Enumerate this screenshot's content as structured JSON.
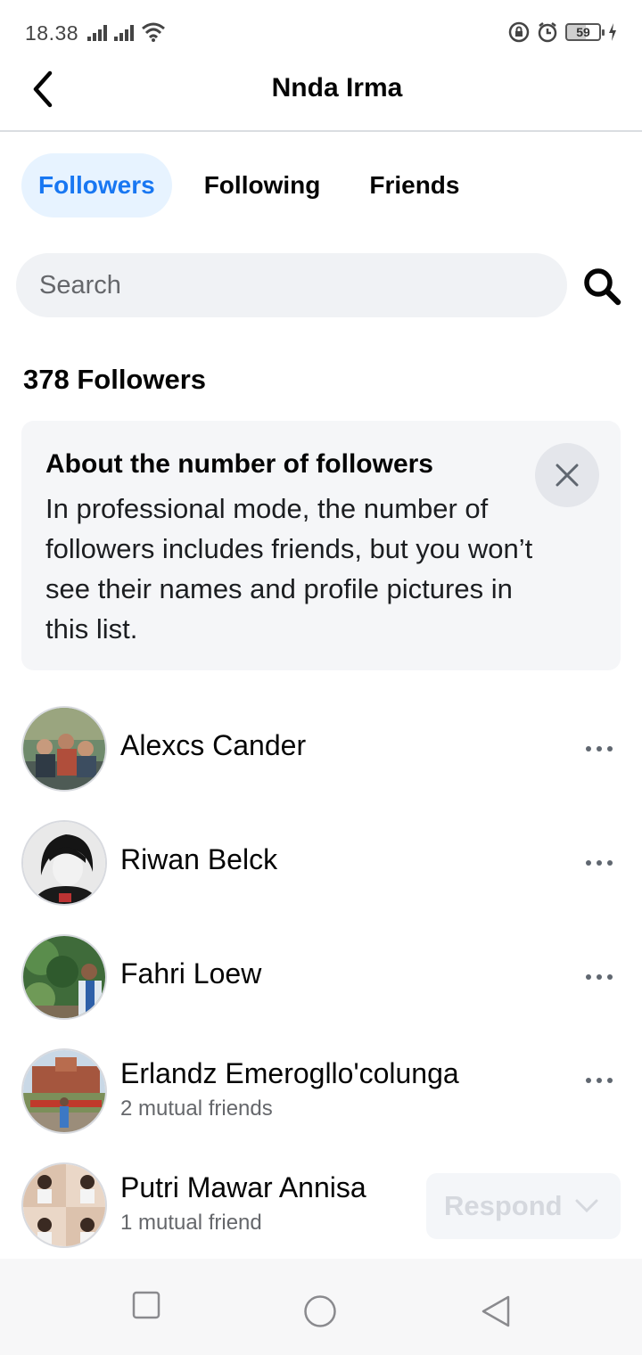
{
  "status_bar": {
    "time": "18.38",
    "battery_level": "59"
  },
  "header": {
    "back_icon": "back-arrow-icon",
    "title": "Nnda Irma"
  },
  "tabs": [
    {
      "label": "Followers",
      "active": true
    },
    {
      "label": "Following",
      "active": false
    },
    {
      "label": "Friends",
      "active": false
    }
  ],
  "search": {
    "placeholder": "Search",
    "icon": "search-icon"
  },
  "followers_count": "378 Followers",
  "info_card": {
    "title": "About the number of followers",
    "body": "In professional mode, the number of followers includes friends, but you won’t see their names and profile pictures in this list.",
    "close_icon": "close-icon"
  },
  "followers": [
    {
      "name": "Alexcs Cander",
      "subtitle": "",
      "action": "more"
    },
    {
      "name": "Riwan Belck",
      "subtitle": "",
      "action": "more"
    },
    {
      "name": "Fahri Loew",
      "subtitle": "",
      "action": "more"
    },
    {
      "name": "Erlandz Emerogllo'colunga",
      "subtitle": "2 mutual friends",
      "action": "more"
    },
    {
      "name": "Putri Mawar Annisa",
      "subtitle": "1 mutual friend",
      "action": "respond"
    }
  ],
  "respond_label": "Respond",
  "colors": {
    "accent": "#1877f2",
    "accent_bg": "#e7f3ff",
    "input_bg": "#f0f2f5",
    "secondary_text": "#65676b"
  },
  "nav": {
    "recents_icon": "square-icon",
    "home_icon": "circle-icon",
    "back_icon": "triangle-back-icon"
  }
}
